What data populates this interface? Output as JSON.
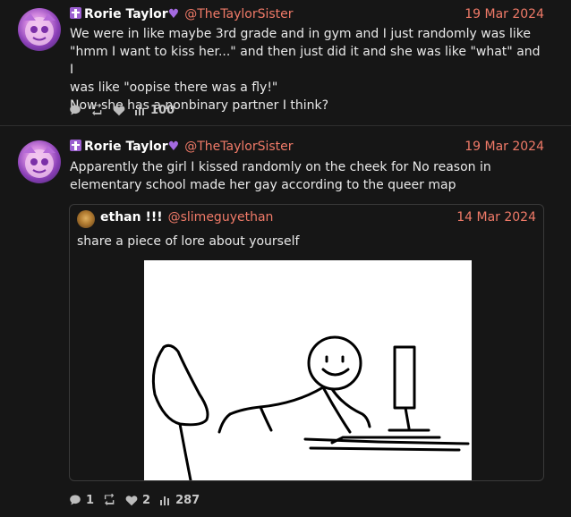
{
  "posts": [
    {
      "author_name": "Rorie Taylor",
      "handle": "@TheTaylorSister",
      "date": "19 Mar 2024",
      "text_lines": [
        "We were in like maybe 3rd grade and in gym and I just randomly was like",
        "\"hmm I want to kiss her...\" and then just did it and she was like \"what\" and I",
        "was like \"oopise there was a fly!\"",
        "Now she has a nonbinary partner I think?"
      ],
      "stats": {
        "replies": "",
        "reposts": "",
        "likes": "",
        "views": "100"
      }
    },
    {
      "author_name": "Rorie Taylor",
      "handle": "@TheTaylorSister",
      "date": "19 Mar 2024",
      "text_lines": [
        "Apparently the girl I kissed randomly on the cheek for No reason in",
        "elementary school made her gay according to the queer map"
      ],
      "quote": {
        "author_name": "ethan !!!",
        "handle": "@slimeguyethan",
        "date": "14 Mar 2024",
        "text": "share a piece of lore about yourself"
      },
      "stats": {
        "replies": "1",
        "reposts": "",
        "likes": "2",
        "views": "287"
      }
    }
  ],
  "colors": {
    "accent": "#f07a68",
    "background": "#161616",
    "heart_emoji": "#a46ae0"
  },
  "icons": {
    "name_prefix": "latin-cross-icon",
    "name_suffix": "purple-heart-icon"
  }
}
